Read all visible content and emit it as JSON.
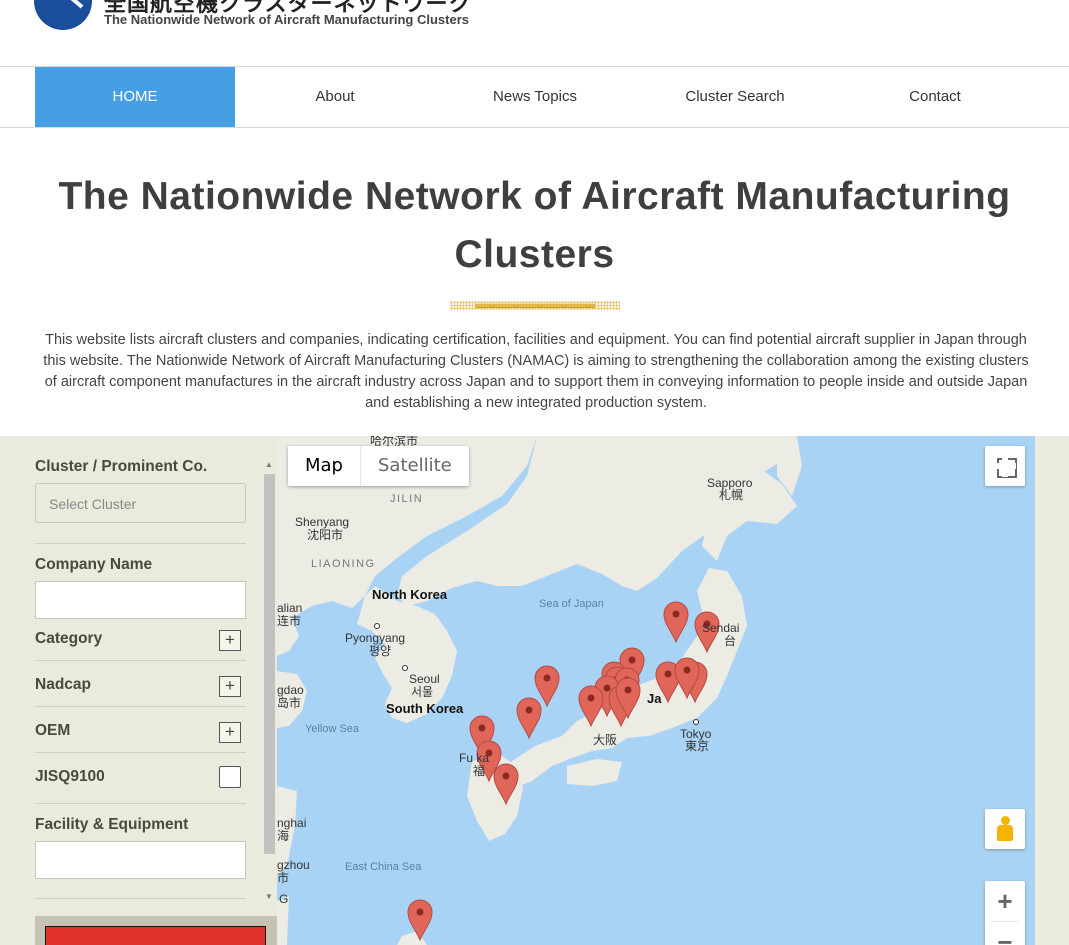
{
  "header": {
    "logo_jp": "全国航空機クラスターネットワーク",
    "logo_en": "The Nationwide Network of Aircraft Manufacturing Clusters"
  },
  "nav": [
    {
      "label": "HOME",
      "active": true
    },
    {
      "label": "About",
      "active": false
    },
    {
      "label": "News Topics",
      "active": false
    },
    {
      "label": "Cluster Search",
      "active": false
    },
    {
      "label": "Contact",
      "active": false
    }
  ],
  "hero": {
    "title": "The Nationwide Network of Aircraft Manufacturing Clusters",
    "intro": "This website lists aircraft clusters and companies, indicating certification, facilities and equipment. You can find potential aircraft supplier in Japan through this website. The Nationwide Network of Aircraft Manufacturing Clusters (NAMAC) is aiming to strengthening the collaboration among the existing clusters of aircraft component manufactures in the aircraft industry across Japan and to support them in conveying information to people inside and outside Japan and establishing a new integrated production system."
  },
  "sidebar": {
    "cluster_label": "Cluster / Prominent Co.",
    "cluster_placeholder": "Select Cluster",
    "company_label": "Company Name",
    "company_value": "",
    "category_label": "Category",
    "nadcap_label": "Nadcap",
    "oem_label": "OEM",
    "jisq_label": "JISQ9100",
    "jisq_checked": false,
    "facility_label": "Facility & Equipment",
    "facility_value": "",
    "expand_symbol": "+"
  },
  "map": {
    "type_map": "Map",
    "type_satellite": "Satellite",
    "selected_type": "Map",
    "zoom_in": "+",
    "zoom_out": "−",
    "labels": {
      "harbin": "哈尔滨市",
      "jilin": "JILIN",
      "shenyang_en": "Shenyang",
      "shenyang_cn": "沈阳市",
      "liaoning": "LIAONING",
      "north_korea": "North Korea",
      "dalian_en": "alian",
      "dalian_cn": "连市",
      "pyongyang_en": "Pyongyang",
      "pyongyang_kr": "평양",
      "seoul_en": "Seoul",
      "seoul_kr": "서울",
      "south_korea": "South Korea",
      "qingdao_en": "gdao",
      "qingdao_cn": "岛市",
      "yellow_sea": "Yellow Sea",
      "sea_of_japan": "Sea of Japan",
      "sapporo_en": "Sapporo",
      "sapporo_jp": "札幌",
      "sendai_en": "Sendai",
      "sendai_jp": "台",
      "tokyo_en": "Tokyo",
      "tokyo_jp": "東京",
      "japan": "Ja",
      "osaka_jp": "大阪",
      "fukuoka_en": "Fu   ka",
      "fukuoka_jp": "福",
      "shanghai_en": "nghai",
      "shanghai_cn": "海",
      "east_china_sea": "East China Sea",
      "hangzhou_en": "gzhou",
      "hangzhou_cn": "市",
      "g": "G"
    },
    "marker_color": "#e0665a",
    "water_color": "#a9d3f5",
    "land_color": "#ecebe4"
  },
  "colors": {
    "nav_active": "#469fe3",
    "panel_bg": "#eaeadd",
    "divider_gold": "#e0b84a",
    "search_button": "#e0322d"
  }
}
